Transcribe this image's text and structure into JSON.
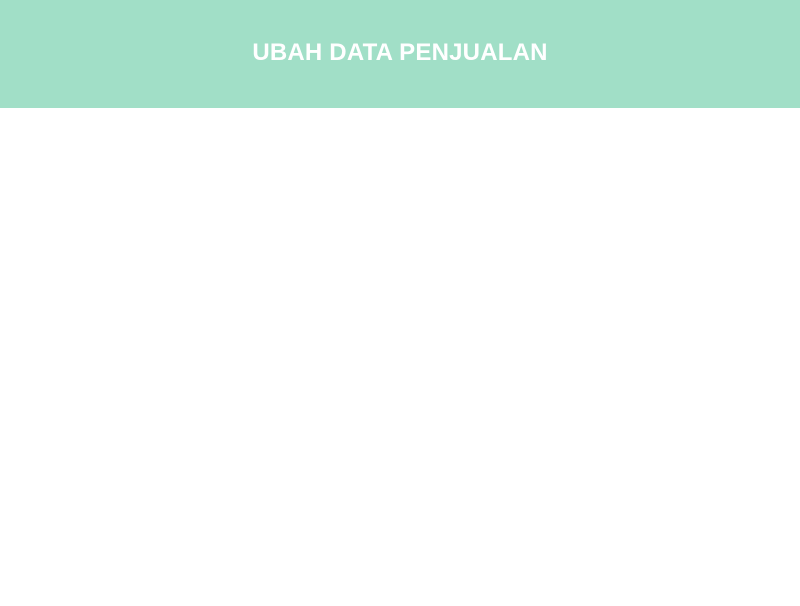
{
  "header": {
    "title": "UBAH DATA PENJUALAN",
    "background_color": "#a1dfc7",
    "text_color": "#ffffff"
  },
  "main": {
    "background_color": "#ffffff"
  }
}
